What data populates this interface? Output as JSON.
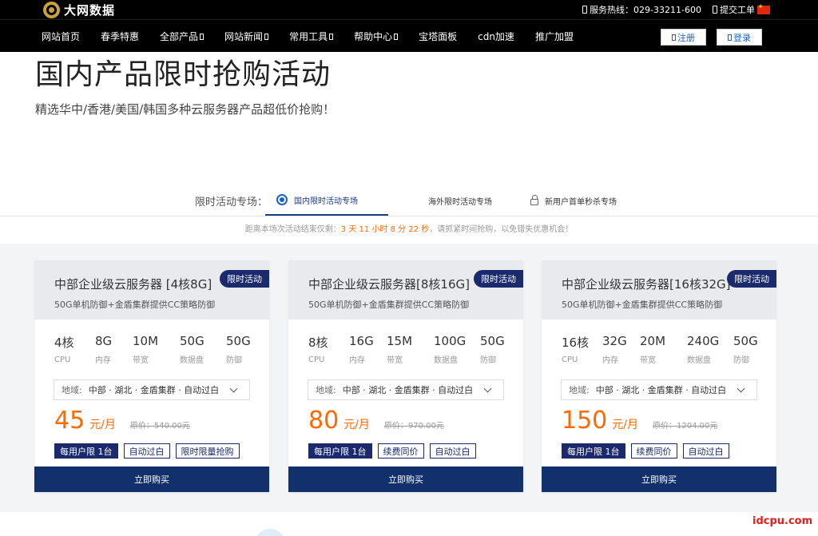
{
  "topbar": {
    "logo_text": "大网数据",
    "hotline": "服务热线：029-33211-600",
    "ticket": "提交工单"
  },
  "nav": {
    "items": [
      {
        "label": "网站首页",
        "has_dropdown": false
      },
      {
        "label": "春季特惠",
        "has_dropdown": false
      },
      {
        "label": "全部产品",
        "has_dropdown": true
      },
      {
        "label": "网站新闻",
        "has_dropdown": true
      },
      {
        "label": "常用工具",
        "has_dropdown": true
      },
      {
        "label": "帮助中心",
        "has_dropdown": true
      },
      {
        "label": "宝塔面板",
        "has_dropdown": false
      },
      {
        "label": "cdn加速",
        "has_dropdown": false
      },
      {
        "label": "推广加盟",
        "has_dropdown": false
      }
    ],
    "register": "注册",
    "login": "登录"
  },
  "hero": {
    "title": "国内产品限时抢购活动",
    "subtitle": "精选华中/香港/美国/韩国多种云服务器产品超低价抢购！"
  },
  "tabs": {
    "label": "限时活动专场：",
    "items": [
      {
        "label": "国内限时活动专场",
        "active": true
      },
      {
        "label": "海外限时活动专场",
        "active": false
      },
      {
        "label": "新用户首单秒杀专场",
        "active": false
      }
    ]
  },
  "countdown": {
    "prefix": "距离本场次活动结束仅剩：",
    "time": "3 天 11 小时 8 分 22 秒",
    "suffix": "，请抓紧时间抢购，以免错失优惠机会！"
  },
  "cards": [
    {
      "title": "中部企业级云服务器 [4核8G]",
      "badge": "限时活动",
      "desc": "50G单机防御+金盾集群提供CC策略防御",
      "specs": [
        {
          "value": "4核",
          "label": "CPU"
        },
        {
          "value": "8G",
          "label": "内存"
        },
        {
          "value": "10M",
          "label": "带宽"
        },
        {
          "value": "50G",
          "label": "数据盘"
        },
        {
          "value": "50G",
          "label": "防御"
        }
      ],
      "region_label": "地域:",
      "region_value": "中部 · 湖北 · 金盾集群 · 自动过白",
      "price": "45",
      "unit": "元/月",
      "original": "原价：540.00元",
      "tags": [
        {
          "label": "每用户限 1台",
          "filled": true
        },
        {
          "label": "自动过白",
          "filled": false
        },
        {
          "label": "限时限量抢购",
          "filled": false
        }
      ],
      "buy": "立即购买"
    },
    {
      "title": "中部企业级云服务器[8核16G]",
      "badge": "限时活动",
      "desc": "50G单机防御+金盾集群提供CC策略防御",
      "specs": [
        {
          "value": "8核",
          "label": "CPU"
        },
        {
          "value": "16G",
          "label": "内存"
        },
        {
          "value": "15M",
          "label": "带宽"
        },
        {
          "value": "100G",
          "label": "数据盘"
        },
        {
          "value": "50G",
          "label": "防御"
        }
      ],
      "region_label": "地域:",
      "region_value": "中部 · 湖北 · 金盾集群 · 自动过白",
      "price": "80",
      "unit": "元/月",
      "original": "原价：970.00元",
      "tags": [
        {
          "label": "每用户限 1台",
          "filled": true
        },
        {
          "label": "续费同价",
          "filled": false
        },
        {
          "label": "自动过白",
          "filled": false
        }
      ],
      "buy": "立即购买"
    },
    {
      "title": "中部企业级云服务器[16核32G]",
      "badge": "限时活动",
      "desc": "50G单机防御+金盾集群提供CC策略防御",
      "specs": [
        {
          "value": "16核",
          "label": "CPU"
        },
        {
          "value": "32G",
          "label": "内存"
        },
        {
          "value": "20M",
          "label": "带宽"
        },
        {
          "value": "240G",
          "label": "数据盘"
        },
        {
          "value": "50G",
          "label": "防御"
        }
      ],
      "region_label": "地域:",
      "region_value": "中部 · 湖北 · 金盾集群 · 自动过白",
      "price": "150",
      "unit": "元/月",
      "original": "原价：1204.00元",
      "tags": [
        {
          "label": "每用户限 1台",
          "filled": true
        },
        {
          "label": "续费同价",
          "filled": false
        },
        {
          "label": "自动过白",
          "filled": false
        }
      ],
      "buy": "立即购买"
    }
  ],
  "watermark": "idcpu.com"
}
